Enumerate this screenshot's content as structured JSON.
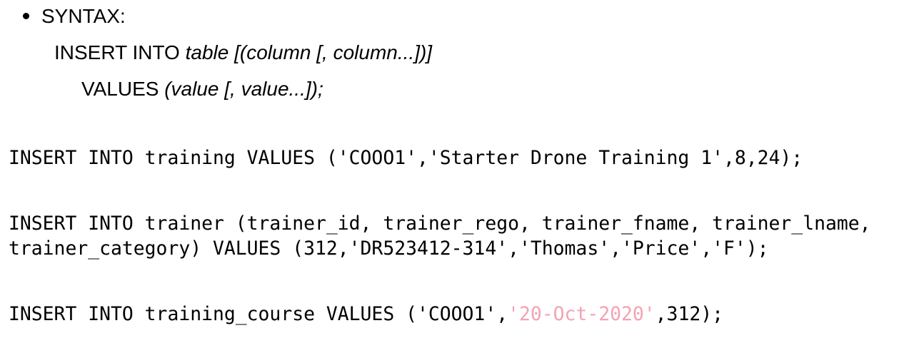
{
  "syntax": {
    "label": "SYNTAX:",
    "line1_keyword": "INSERT INTO ",
    "line1_italic": "table [(column [, column...])]",
    "line2_keyword": "VALUES ",
    "line2_italic": "(value [, value...]);"
  },
  "examples": {
    "training": "INSERT INTO training VALUES ('COOO1','Starter Drone Training 1',8,24);",
    "trainer_line1": "INSERT INTO trainer (trainer_id, trainer_rego, trainer_fname, trainer_lname,",
    "trainer_line2": "trainer_category) VALUES (312,'DR523412-314','Thomas','Price','F');",
    "course_prefix": "INSERT INTO training_course VALUES ('COOO1',",
    "course_date": "'20-Oct-2020'",
    "course_suffix": ",312);"
  },
  "colors": {
    "text": "#000000",
    "date_literal": "#f4a3b3",
    "background": "#ffffff"
  }
}
